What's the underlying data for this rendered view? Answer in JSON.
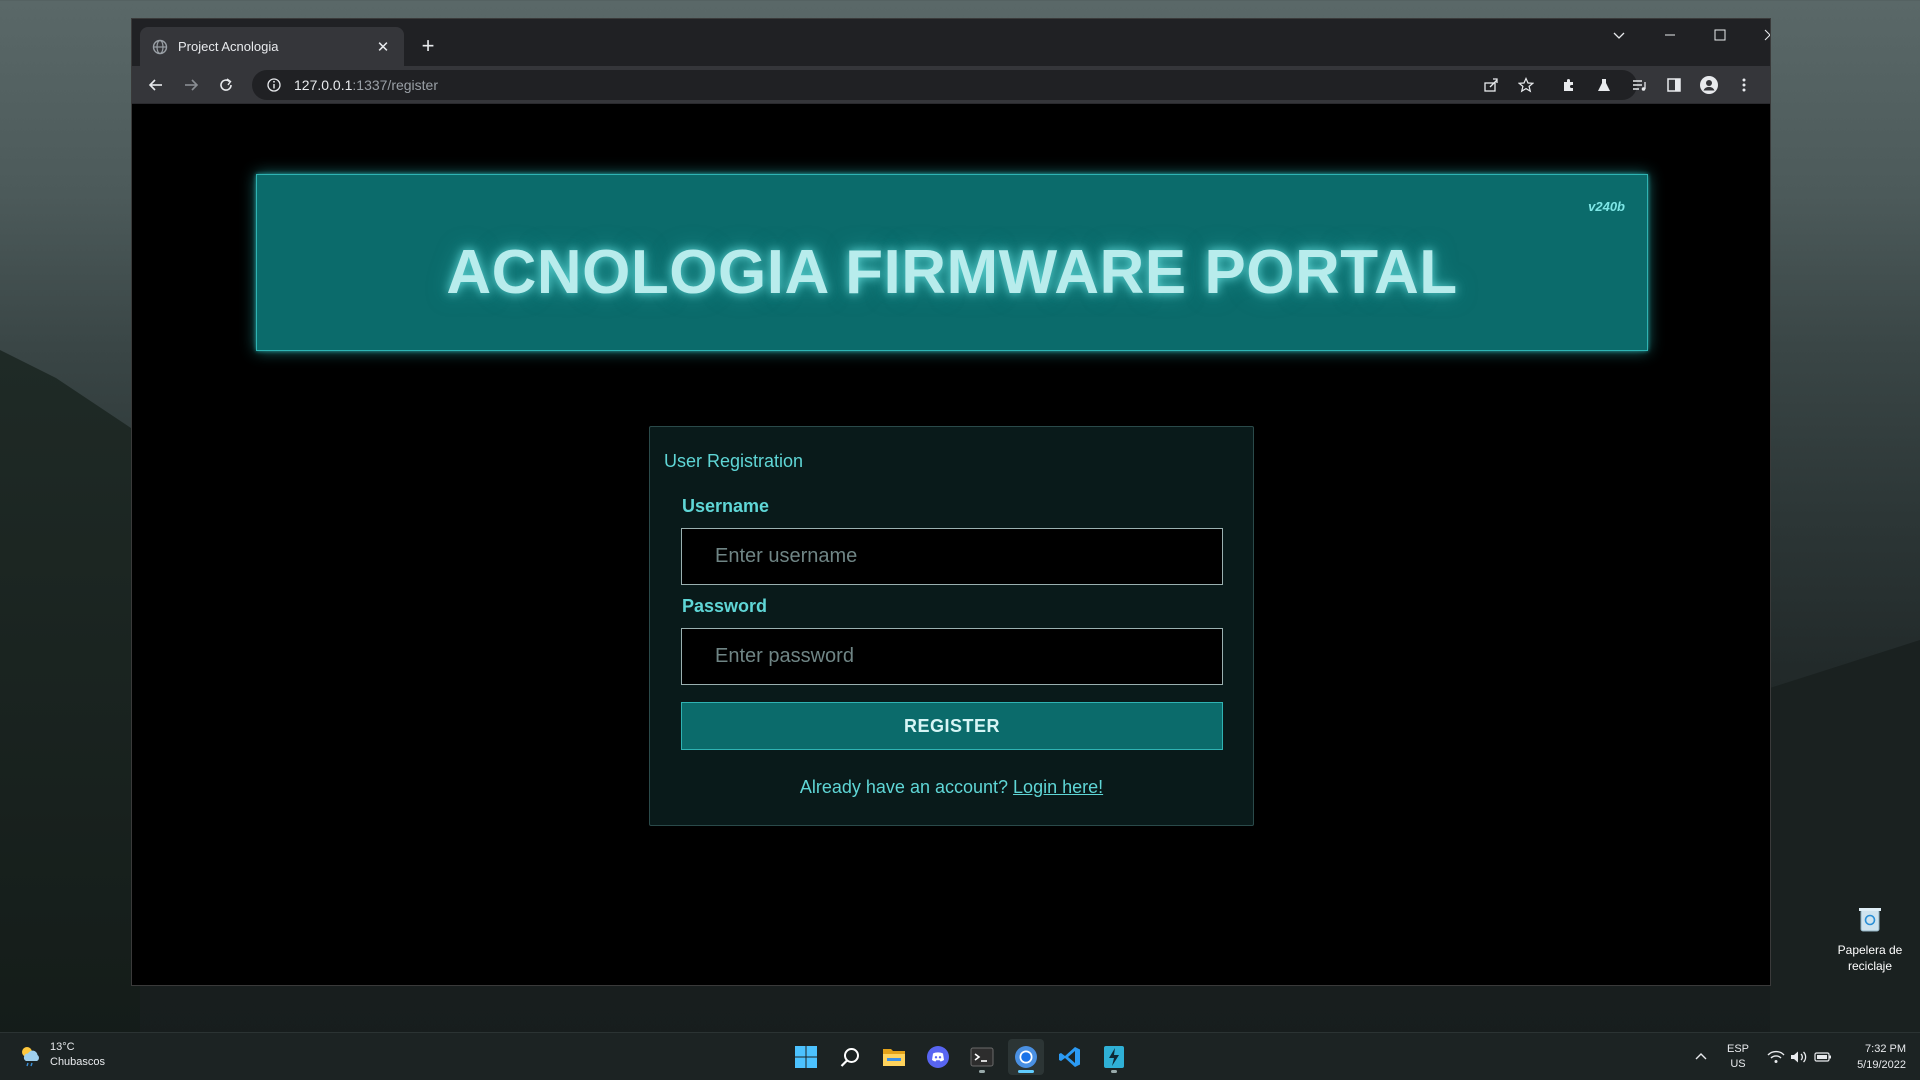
{
  "browser": {
    "tab_title": "Project Acnologia",
    "url_host": "127.0.0.1",
    "url_path": ":1337/register"
  },
  "page": {
    "version": "v240b",
    "heading": "ACNOLOGIA FIRMWARE PORTAL",
    "form": {
      "title": "User Registration",
      "username_label": "Username",
      "username_placeholder": "Enter username",
      "password_label": "Password",
      "password_placeholder": "Enter password",
      "submit_label": "REGISTER",
      "login_prompt": "Already have an account?",
      "login_link": "Login here!"
    }
  },
  "desktop": {
    "recycle_bin_label": "Papelera de reciclaje"
  },
  "taskbar": {
    "weather_temp": "13°C",
    "weather_desc": "Chubascos",
    "lang_top": "ESP",
    "lang_bottom": "US",
    "time": "7:32 PM",
    "date": "5/19/2022",
    "pinned": [
      "start-icon",
      "search-icon",
      "file-explorer-icon",
      "discord-icon",
      "terminal-icon",
      "chrome-icon",
      "vscode-icon",
      "app-icon"
    ]
  },
  "colors": {
    "accent_teal": "#0b6b6b",
    "text_teal": "#5fd6d6",
    "glow": "#2fb3b3"
  }
}
